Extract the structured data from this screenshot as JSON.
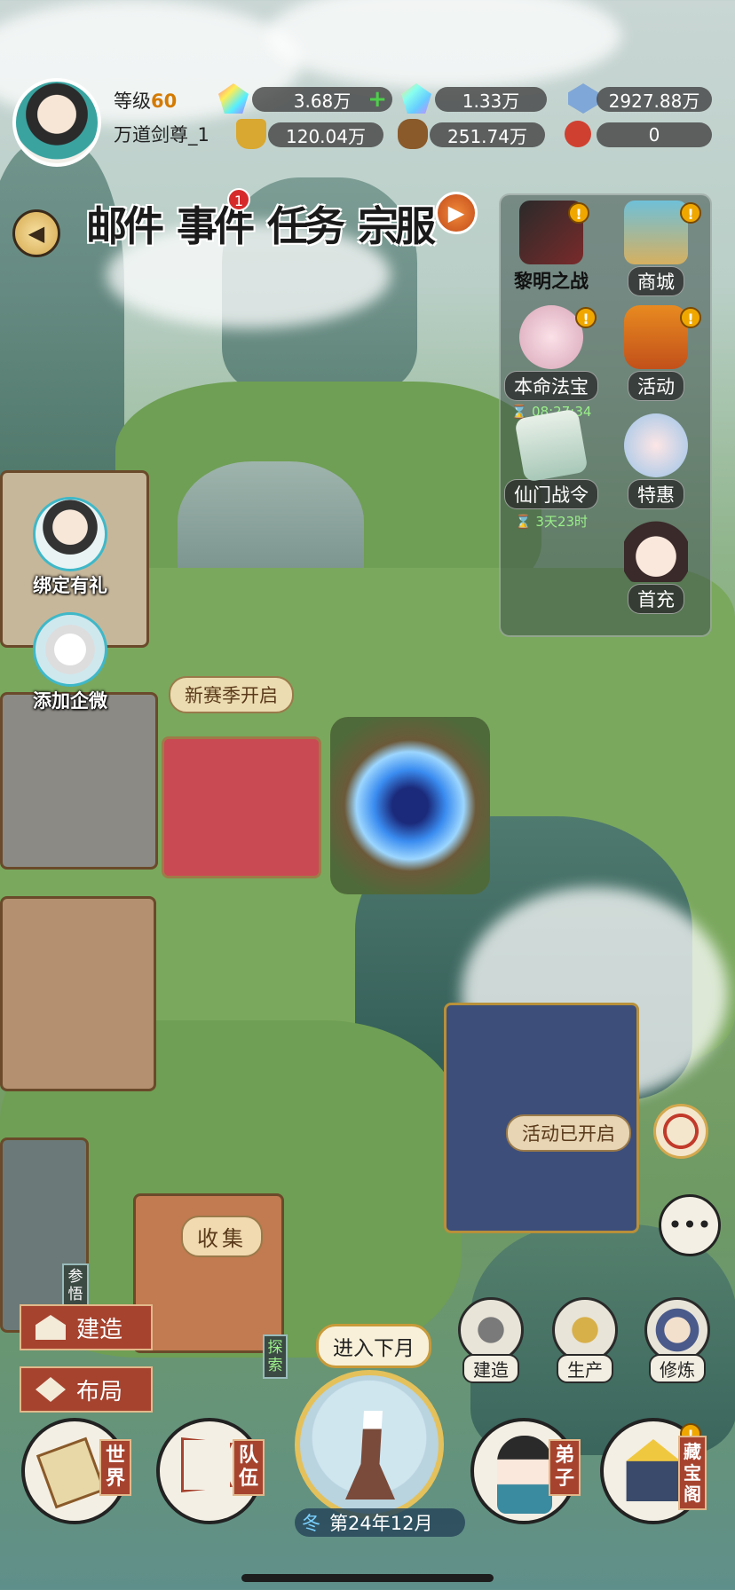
{
  "hud": {
    "level_label": "等级",
    "level_value": "60",
    "player_name": "万道剑尊_1",
    "resources": [
      {
        "name": "jade-rainbow",
        "value": "3.68万",
        "has_plus": true,
        "icon_color": "#8ee0e0"
      },
      {
        "name": "jade-rainbow-bound",
        "value": "1.33万",
        "icon_color": "#a6e6c8"
      },
      {
        "name": "spirit-crystal",
        "value": "2927.88万",
        "icon_color": "#7fa7d8"
      },
      {
        "name": "gold-ingot",
        "value": "120.04万",
        "icon_color": "#d9a830"
      },
      {
        "name": "wood-log",
        "value": "251.74万",
        "icon_color": "#8a5a2a"
      },
      {
        "name": "red-token",
        "value": "0",
        "icon_color": "#d04030"
      }
    ]
  },
  "event_tabs": [
    {
      "label": "邮件",
      "name": "mail"
    },
    {
      "label": "事件",
      "name": "events",
      "badge": "1"
    },
    {
      "label": "任务",
      "name": "tasks"
    },
    {
      "label": "宗服",
      "name": "sect-server"
    }
  ],
  "activities": [
    {
      "label": "黎明之战",
      "name": "dawn-battle",
      "warn": true
    },
    {
      "label": "商城",
      "name": "shop",
      "warn": true
    },
    {
      "label": "本命法宝",
      "name": "natal-treasure",
      "warn": true,
      "timer": "08:27:34"
    },
    {
      "label": "活动",
      "name": "activity",
      "warn": true
    },
    {
      "label": "仙门战令",
      "name": "battle-pass",
      "timer": "3天23时"
    },
    {
      "label": "特惠",
      "name": "special-offer"
    },
    {
      "label": "首充",
      "name": "first-recharge"
    }
  ],
  "side_gifts": [
    {
      "label": "绑定有礼",
      "name": "bind-gift"
    },
    {
      "label": "添加企微",
      "name": "add-wecom"
    }
  ],
  "map_labels": {
    "new_season": "新赛季开启",
    "activity_open": "活动已开启",
    "collect": "收集",
    "insight": "参悟",
    "explore": "探索"
  },
  "left_actions": {
    "build": "建造",
    "layout": "布局"
  },
  "right_actions": [
    {
      "label": "建造",
      "name": "construct"
    },
    {
      "label": "生产",
      "name": "produce"
    },
    {
      "label": "修炼",
      "name": "cultivate"
    }
  ],
  "bottom_nav": [
    {
      "label": "世界",
      "name": "world"
    },
    {
      "label": "队伍",
      "name": "team"
    },
    {
      "label": "弟子",
      "name": "disciples"
    },
    {
      "label": "藏宝阁",
      "name": "treasure-pavilion",
      "warn": true
    }
  ],
  "calendar": {
    "next_month": "进入下月",
    "season": "冬",
    "date": "第24年12月"
  }
}
